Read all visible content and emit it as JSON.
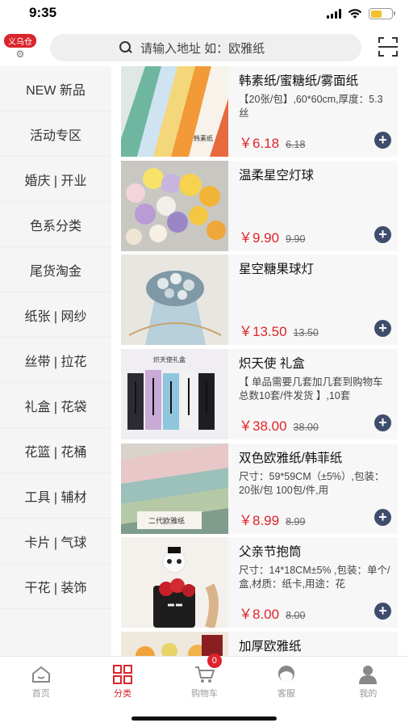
{
  "status": {
    "time": "9:35"
  },
  "header": {
    "location_tag": "义乌仓",
    "search_placeholder": "请输入地址  如：欧雅纸"
  },
  "sidebar": {
    "items": [
      {
        "label": "NEW 新品"
      },
      {
        "label": "活动专区"
      },
      {
        "label": "婚庆 | 开业"
      },
      {
        "label": "色系分类"
      },
      {
        "label": "尾货淘金"
      },
      {
        "label": "纸张 | 网纱"
      },
      {
        "label": "丝带 | 拉花"
      },
      {
        "label": "礼盒 | 花袋"
      },
      {
        "label": "花篮 | 花桶"
      },
      {
        "label": "工具 | 辅材"
      },
      {
        "label": "卡片 | 气球"
      },
      {
        "label": "干花 | 装饰"
      }
    ]
  },
  "products": [
    {
      "title": "韩素纸/蜜糖纸/雾面纸",
      "desc": "【20张/包】,60*60cm,厚度：5.3丝",
      "price": "￥6.18",
      "orig": "6.18",
      "thumb_caption": "韩素纸"
    },
    {
      "title": "温柔星空灯球",
      "desc": "",
      "price": "￥9.90",
      "orig": "9.90"
    },
    {
      "title": "星空糖果球灯",
      "desc": "",
      "price": "￥13.50",
      "orig": "13.50"
    },
    {
      "title": "炽天使 礼盒",
      "desc": "【 单品需要几套加几套到购物车 总数10套/件发货 】,10套",
      "price": "￥38.00",
      "orig": "38.00",
      "thumb_caption": "炽天使礼盒"
    },
    {
      "title": "双色欧雅纸/韩菲纸",
      "desc": "尺寸：59*59CM（±5%）,包装：20张/包 100包/件,用",
      "price": "￥8.99",
      "orig": "8.99",
      "thumb_caption": "二代欧雅纸"
    },
    {
      "title": "父亲节抱筒",
      "desc": "尺寸：14*18CM±5% ,包装：单个/盒,材质：纸卡,用途：花",
      "price": "￥8.00",
      "orig": "8.00"
    },
    {
      "title": "加厚欧雅纸",
      "desc": "",
      "price": "",
      "orig": ""
    }
  ],
  "tabbar": {
    "tabs": [
      {
        "label": "首页"
      },
      {
        "label": "分类"
      },
      {
        "label": "购物车"
      },
      {
        "label": "客服"
      },
      {
        "label": "我的"
      }
    ],
    "cart_count": "0",
    "active_color": "#d9262c"
  }
}
